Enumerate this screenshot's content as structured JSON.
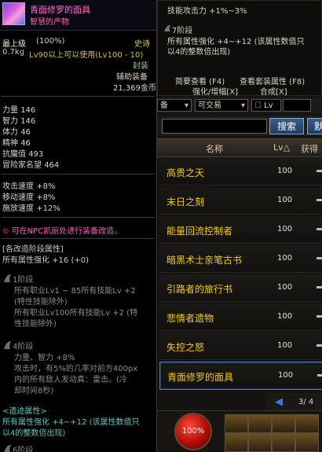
{
  "tooltip": {
    "item_name": "青面修罗的面具",
    "subtitle": "智慧的产物",
    "grade_label": "最上级",
    "grade_pct": "(100%)",
    "rarity": "史诗",
    "weight": "0.7kg",
    "level_req": "Lv90以上可以使用(Lv100 - 10)",
    "seal": "封装",
    "slot_type": "辅助装备",
    "price": "21,369金币",
    "stats": [
      {
        "label": "力量",
        "value": "146"
      },
      {
        "label": "智力",
        "value": "146"
      },
      {
        "label": "体力",
        "value": "46"
      },
      {
        "label": "精神",
        "value": "46"
      },
      {
        "label": "抗魔值",
        "value": "493"
      },
      {
        "label": "冒险家名望",
        "value": "464"
      }
    ],
    "speeds": [
      {
        "label": "攻击速度",
        "value": "+8%"
      },
      {
        "label": "移动速度",
        "value": "+8%"
      },
      {
        "label": "施放速度",
        "value": "+12%"
      }
    ],
    "npc_note": "可在NPC凯丽处进行装备改造。",
    "upgrade_header": "[各改造阶段属性]",
    "upgrade_line": "所有属性强化 +16",
    "upgrade_plus": "(+0)",
    "step1_label": "1阶段",
    "step1_lines": [
      "所有职业Lv1 ~ 85所有技能Lv +2",
      "(特性技能除外)",
      "所有职业Lv100所有技能Lv +2 (特",
      "性技能除外)"
    ],
    "step4_label": "4阶段",
    "step4_lines": [
      "力量、智力 +8%",
      "攻击时，有5%的几率对前方400px",
      "内的所有敌人发动真：雷击。(冷",
      "却时间8秒)"
    ],
    "lost_header": "<遗迹属性>",
    "lost_line1": "所有属性强化 +4~+12 (该属性数值只",
    "lost_line2": "以4的整数倍出现)",
    "step6_label": "6阶段"
  },
  "set_popup": {
    "skill_line": "技能攻击力 +1%~3%",
    "step7_label": "7阶段",
    "step7_line1": "所有属性强化 +4~+12 (该属性数值只",
    "step7_line2": "以4的整数倍出现)",
    "brief_view": "简要查看 (F4)",
    "set_view": "查看套装属性 (F8)",
    "enhance": "强化/增幅[X]",
    "combine": "合成[X]"
  },
  "filters": {
    "equip_frag": "备",
    "tradable": "可交易",
    "lv_frag": "Lv"
  },
  "search": {
    "button": "搜索",
    "button2": "默"
  },
  "list": {
    "col_name": "名称",
    "col_lv": "Lv△",
    "col_get": "获得",
    "items": [
      {
        "name": "高贵之天",
        "lv": "100"
      },
      {
        "name": "末日之刻",
        "lv": "100"
      },
      {
        "name": "能量回流控制者",
        "lv": "100"
      },
      {
        "name": "暗黑术士亲笔古书",
        "lv": "100"
      },
      {
        "name": "引路者的旅行书",
        "lv": "100"
      },
      {
        "name": "悲情者遗物",
        "lv": "100"
      },
      {
        "name": "失控之怒",
        "lv": "100"
      },
      {
        "name": "青面修罗的面具",
        "lv": "100"
      }
    ]
  },
  "pager": {
    "text": "3/ 4"
  },
  "hud": {
    "hp": "100%"
  }
}
